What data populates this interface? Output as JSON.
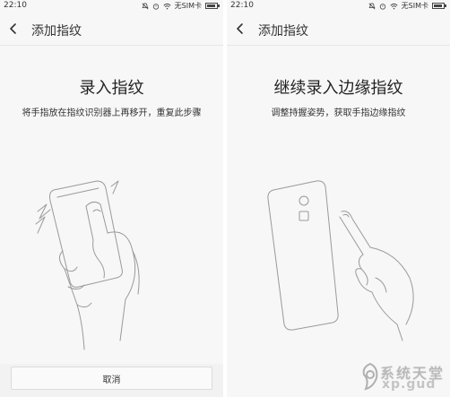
{
  "left_screen": {
    "status": {
      "time": "22:10",
      "sim": "无SIM卡"
    },
    "title": "添加指纹",
    "heading": "录入指纹",
    "instruction": "将手指放在指纹识别器上再移开，重复此步骤",
    "cancel_label": "取消"
  },
  "right_screen": {
    "status": {
      "time": "22:10",
      "sim": "无SIM卡"
    },
    "title": "添加指纹",
    "heading": "继续录入边缘指纹",
    "instruction": "调整持握姿势，获取手指边缘指纹"
  },
  "watermark": {
    "text": "系统天堂",
    "sub": "xp.gud"
  },
  "icons": [
    "back-arrow-icon",
    "mute-icon",
    "alarm-icon",
    "wifi-icon",
    "battery-icon"
  ],
  "colors": {
    "background": "#f7f7f7",
    "text": "#333333",
    "button_border": "#dcdcdc"
  }
}
